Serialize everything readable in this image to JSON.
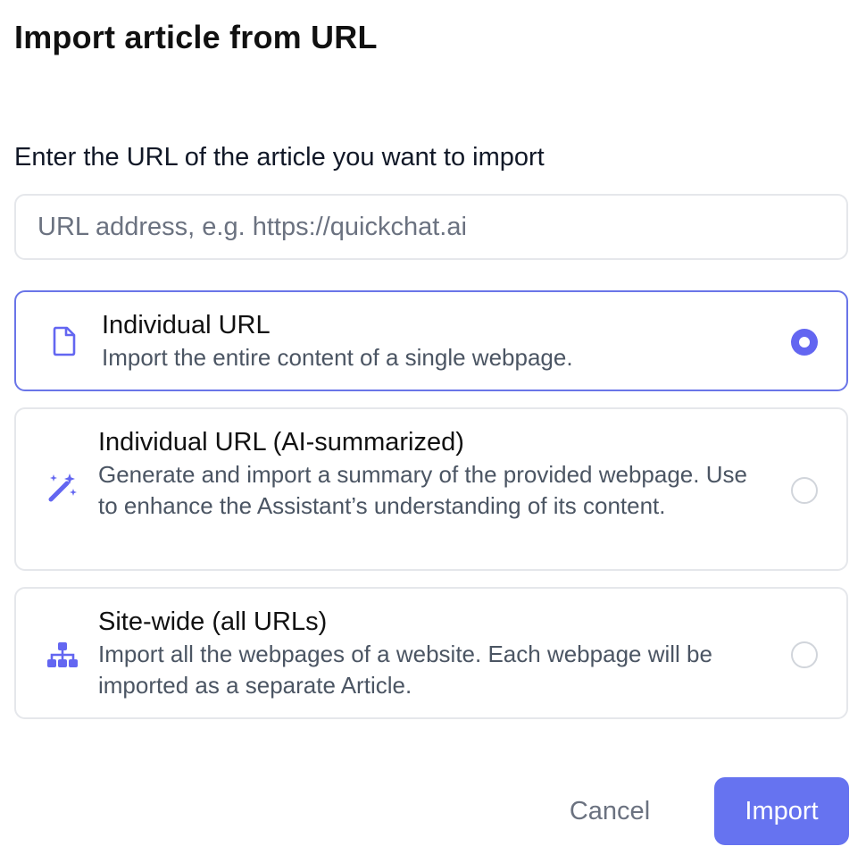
{
  "dialog": {
    "title": "Import article from URL",
    "field_label": "Enter the URL of the article you want to import",
    "url_input": {
      "value": "",
      "placeholder": "URL address, e.g. https://quickchat.ai"
    }
  },
  "options": [
    {
      "icon": "document-icon",
      "title": "Individual URL",
      "description": "Import the entire content of a single webpage.",
      "selected": true
    },
    {
      "icon": "magic-wand-icon",
      "title": "Individual URL (AI-summarized)",
      "description": "Generate and import a summary of the provided webpage. Use to enhance the Assistant’s understanding of its content.",
      "selected": false
    },
    {
      "icon": "sitemap-icon",
      "title": "Site-wide (all URLs)",
      "description": "Import all the webpages of a website. Each webpage will be imported as a separate Article.",
      "selected": false
    }
  ],
  "actions": {
    "cancel_label": "Cancel",
    "import_label": "Import"
  },
  "colors": {
    "accent": "#6366f1",
    "import_button": "#6673f0",
    "selected_border": "#6a75e8",
    "icon": "#6366f1",
    "border": "#e5e7eb",
    "muted_text": "#6b7280"
  }
}
